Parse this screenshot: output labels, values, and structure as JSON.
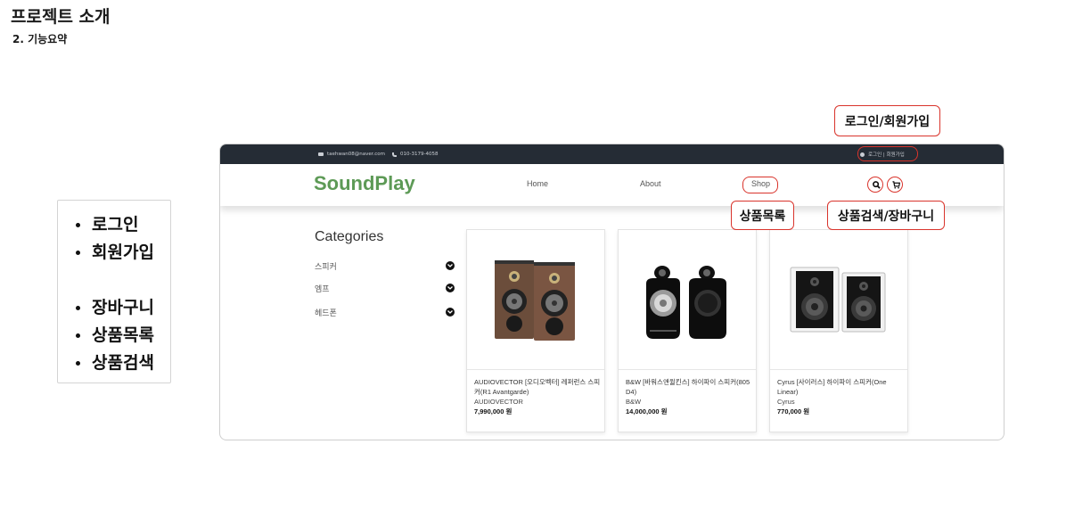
{
  "slide": {
    "title": "프로젝트 소개",
    "subtitle": "2. 기능요약"
  },
  "features": {
    "group1": [
      "로그인",
      "회원가입"
    ],
    "group2": [
      "장바구니",
      "상품목록",
      "상품검색"
    ]
  },
  "site": {
    "topbar": {
      "email": "taehwan08@naver.com",
      "phone": "010-3179-4058",
      "auth": "로그인 | 회원가입"
    },
    "logo": "SoundPlay",
    "nav": [
      "Home",
      "About",
      "Shop"
    ],
    "icons": {
      "search": "search-icon",
      "cart": "cart-icon"
    },
    "categories": {
      "title": "Categories",
      "items": [
        "스피커",
        "엠프",
        "헤드폰"
      ]
    },
    "products": [
      {
        "name": "AUDIOVECTOR [오디오벡터] 레퍼런스 스피커(R1 Avantgarde)",
        "brand": "AUDIOVECTOR",
        "price": "7,990,000 원"
      },
      {
        "name": "B&W [바워스앤윌킨스] 하이파이 스피커(805 D4)",
        "brand": "B&W",
        "price": "14,000,000 원"
      },
      {
        "name": "Cyrus [사이러스] 하이파이 스피커(One Linear)",
        "brand": "Cyrus",
        "price": "770,000 원"
      }
    ],
    "colors": {
      "logo": "#5d9a56",
      "topbar": "#252c35",
      "accent": "#d9342c"
    }
  },
  "callouts": {
    "auth": "로그인/회원가입",
    "shop": "상품목록",
    "search_cart": "상품검색/장바구니"
  }
}
